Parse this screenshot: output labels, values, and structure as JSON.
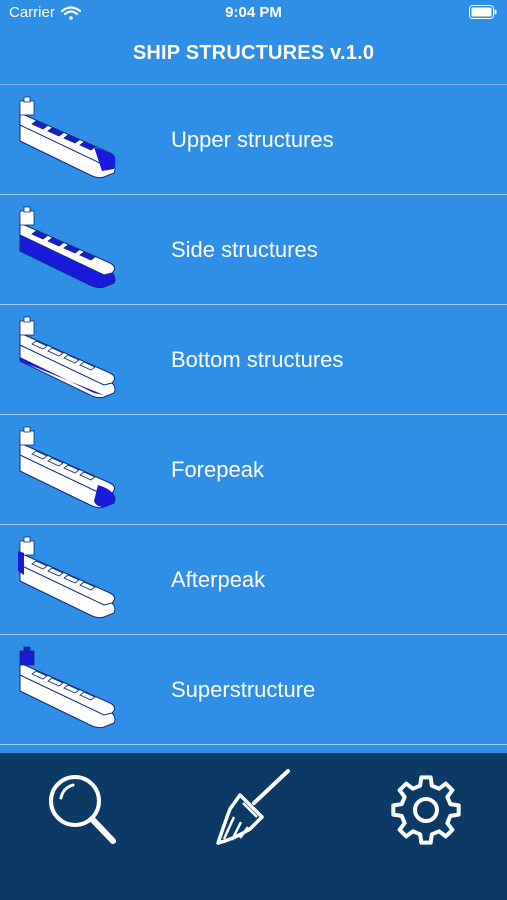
{
  "status_bar": {
    "carrier": "Carrier",
    "time": "9:04 PM",
    "wifi_icon": "wifi-icon",
    "battery_icon": "battery-icon"
  },
  "nav": {
    "title": "SHIP STRUCTURES v.1.0"
  },
  "items": [
    {
      "label": "Upper structures",
      "icon": "ship-upper-structures-icon",
      "highlight": "upper"
    },
    {
      "label": "Side structures",
      "icon": "ship-side-structures-icon",
      "highlight": "side"
    },
    {
      "label": "Bottom structures",
      "icon": "ship-bottom-structures-icon",
      "highlight": "bottom"
    },
    {
      "label": "Forepeak",
      "icon": "ship-forepeak-icon",
      "highlight": "forepeak"
    },
    {
      "label": "Afterpeak",
      "icon": "ship-afterpeak-icon",
      "highlight": "afterpeak"
    },
    {
      "label": "Superstructure",
      "icon": "ship-superstructure-icon",
      "highlight": "superstructure"
    }
  ],
  "tab_bar": {
    "buttons": [
      {
        "icon": "search-icon"
      },
      {
        "icon": "broom-icon"
      },
      {
        "icon": "gear-icon"
      }
    ]
  },
  "colors": {
    "background": "#2f8ee6",
    "tab_bar": "#0b3a66",
    "highlight": "#1a1adc",
    "text": "#ffffff"
  }
}
